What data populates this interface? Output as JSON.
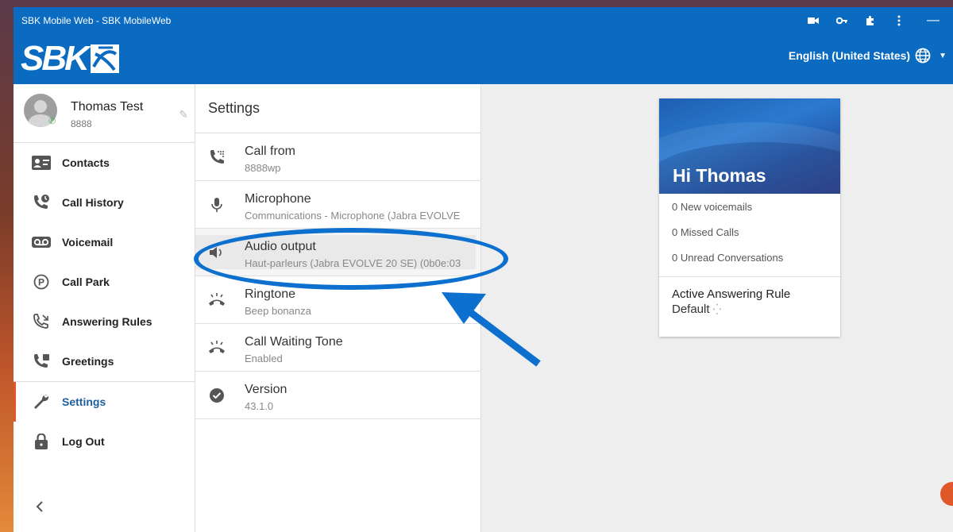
{
  "window": {
    "title": "SBK Mobile Web - SBK MobileWeb"
  },
  "header": {
    "logo_text": "SBK",
    "logo_sub": "TELECOM",
    "language": "English (United States)"
  },
  "profile": {
    "name": "Thomas Test",
    "extension": "8888"
  },
  "nav": {
    "items": [
      {
        "label": "Contacts",
        "icon": "contacts-icon"
      },
      {
        "label": "Call History",
        "icon": "call-history-icon"
      },
      {
        "label": "Voicemail",
        "icon": "voicemail-icon"
      },
      {
        "label": "Call Park",
        "icon": "call-park-icon"
      },
      {
        "label": "Answering Rules",
        "icon": "answering-rules-icon"
      },
      {
        "label": "Greetings",
        "icon": "greetings-icon"
      },
      {
        "label": "Settings",
        "icon": "wrench-icon"
      },
      {
        "label": "Log Out",
        "icon": "lock-icon"
      }
    ],
    "active": "Settings"
  },
  "settings": {
    "title": "Settings",
    "rows": [
      {
        "label": "Call from",
        "value": "8888wp",
        "icon": "phone-dialpad-icon"
      },
      {
        "label": "Microphone",
        "value": "Communications - Microphone (Jabra EVOLVE",
        "icon": "microphone-icon"
      },
      {
        "label": "Audio output",
        "value": "Haut-parleurs (Jabra EVOLVE 20 SE) (0b0e:03",
        "icon": "speaker-icon"
      },
      {
        "label": "Ringtone",
        "value": "Beep bonanza",
        "icon": "ringtone-icon"
      },
      {
        "label": "Call Waiting Tone",
        "value": "Enabled",
        "icon": "call-waiting-icon"
      },
      {
        "label": "Version",
        "value": "43.1.0",
        "icon": "check-circle-icon"
      }
    ]
  },
  "card": {
    "greeting": "Hi Thomas",
    "stats": [
      "0 New voicemails",
      "0 Missed Calls",
      "0 Unread Conversations"
    ],
    "rule_title": "Active Answering Rule",
    "rule_value": "Default"
  },
  "colors": {
    "primary": "#0a6bc1",
    "accent": "#e0582a",
    "annotation": "#0d6fce"
  }
}
